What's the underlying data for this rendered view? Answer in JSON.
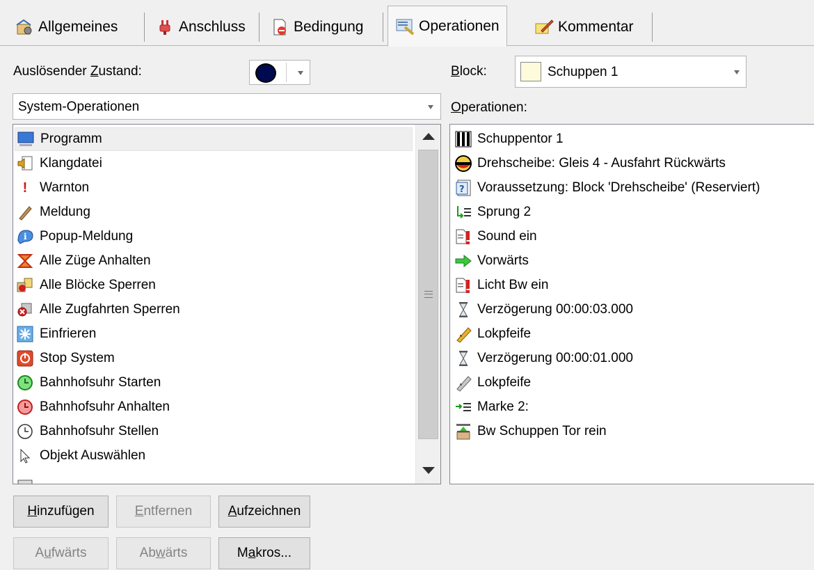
{
  "tabs": [
    {
      "label": "Allgemeines",
      "icon": "settings-icon"
    },
    {
      "label": "Anschluss",
      "icon": "plug-icon"
    },
    {
      "label": "Bedingung",
      "icon": "condition-icon"
    },
    {
      "label": "Operationen",
      "icon": "operations-icon",
      "active": true
    },
    {
      "label": "Kommentar",
      "icon": "comment-icon"
    }
  ],
  "trigger": {
    "label_pre": "Auslösender ",
    "label_u": "Z",
    "label_post": "ustand:",
    "color": "#000a50"
  },
  "block": {
    "label_u": "B",
    "label_post": "lock:",
    "value": "Schuppen 1",
    "swatch_color": "#fdfbdc"
  },
  "category": {
    "value": "System-Operationen"
  },
  "operations_label": {
    "u": "O",
    "rest": "perationen:"
  },
  "available": [
    {
      "label": "Programm",
      "icon": "monitor-icon",
      "selected": true
    },
    {
      "label": "Klangdatei",
      "icon": "sound-file-icon"
    },
    {
      "label": "Warnton",
      "icon": "exclamation-icon"
    },
    {
      "label": "Meldung",
      "icon": "pencil-icon"
    },
    {
      "label": "Popup-Meldung",
      "icon": "info-icon"
    },
    {
      "label": "Alle Züge Anhalten",
      "icon": "stop-trains-icon"
    },
    {
      "label": "Alle Blöcke Sperren",
      "icon": "lock-blocks-icon"
    },
    {
      "label": "Alle Zugfahrten Sperren",
      "icon": "lock-routes-icon"
    },
    {
      "label": "Einfrieren",
      "icon": "snowflake-icon"
    },
    {
      "label": "Stop System",
      "icon": "power-icon"
    },
    {
      "label": "Bahnhofsuhr Starten",
      "icon": "clock-green-icon"
    },
    {
      "label": "Bahnhofsuhr Anhalten",
      "icon": "clock-red-icon"
    },
    {
      "label": "Bahnhofsuhr Stellen",
      "icon": "clock-icon"
    },
    {
      "label": "Objekt Auswählen",
      "icon": "cursor-icon"
    }
  ],
  "operations": [
    {
      "label": "Schuppentor 1",
      "icon": "gate-icon"
    },
    {
      "label": "Drehscheibe: Gleis 4 - Ausfahrt Rückwärts",
      "icon": "turntable-icon"
    },
    {
      "label": "Voraussetzung: Block 'Drehscheibe' (Reserviert)",
      "icon": "precondition-icon"
    },
    {
      "label": "Sprung 2",
      "icon": "jump-icon"
    },
    {
      "label": "Sound ein",
      "icon": "function-icon"
    },
    {
      "label": "Vorwärts",
      "icon": "forward-arrow-icon"
    },
    {
      "label": "Licht Bw ein",
      "icon": "function-icon"
    },
    {
      "label": "Verzögerung 00:00:03.000",
      "icon": "hourglass-icon"
    },
    {
      "label": "Lokpfeife",
      "icon": "whistle-icon"
    },
    {
      "label": "Verzögerung 00:00:01.000",
      "icon": "hourglass-icon"
    },
    {
      "label": "Lokpfeife",
      "icon": "whistle-grey-icon"
    },
    {
      "label": "Marke 2:",
      "icon": "label-icon"
    },
    {
      "label": "Bw Schuppen Tor rein",
      "icon": "route-icon"
    }
  ],
  "buttons": {
    "add": {
      "u": "H",
      "rest": "inzufügen"
    },
    "remove": {
      "u": "E",
      "rest": "ntfernen"
    },
    "record": {
      "u": "A",
      "rest": "ufzeichnen"
    },
    "up_pre": "A",
    "up_u": "u",
    "up_post": "fwärts",
    "down_pre": "Ab",
    "down_u": "w",
    "down_post": "ärts",
    "macros_pre": "M",
    "macros_u": "a",
    "macros_post": "kros..."
  }
}
